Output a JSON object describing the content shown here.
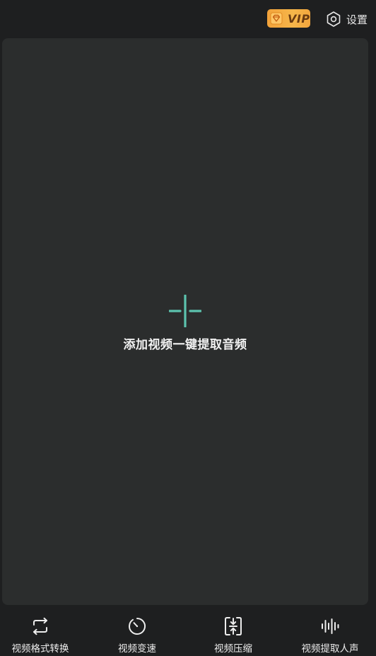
{
  "topbar": {
    "vip_label": "VIP",
    "settings_label": "设置"
  },
  "main": {
    "add_label": "添加视频一键提取音频"
  },
  "bottom_nav": {
    "items": [
      {
        "label": "视频格式转换",
        "icon": "convert-icon"
      },
      {
        "label": "视频变速",
        "icon": "speed-icon"
      },
      {
        "label": "视频压缩",
        "icon": "compress-icon"
      },
      {
        "label": "视频提取人声",
        "icon": "waveform-icon"
      }
    ]
  },
  "colors": {
    "background": "#1e1f20",
    "panel": "#2b2d2d",
    "accent": "#5cc3ae",
    "vip_gold": "#f6b64a",
    "vip_text": "#6a3a10"
  }
}
